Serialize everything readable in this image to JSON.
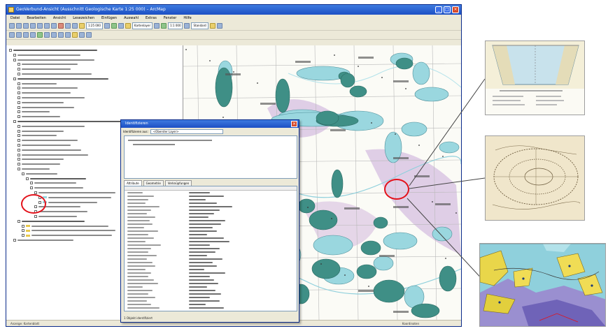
{
  "window": {
    "title": "GeoVerbund-Ansicht (Ausschnitt Geologische Karte 1:25 000) – ArcMap",
    "minimize": "_",
    "maximize": "□",
    "close": "×"
  },
  "menu": [
    "Datei",
    "Bearbeiten",
    "Ansicht",
    "Lesezeichen",
    "Einfügen",
    "Auswahl",
    "Extras",
    "Fenster",
    "Hilfe"
  ],
  "toolbar": {
    "scale": "1:25 000",
    "layer_combo": "Kartenlayer",
    "zoom_combo": "1:1 000",
    "style_combo": "Standard"
  },
  "dialog": {
    "title": "Identifizieren",
    "close": "×",
    "identify_from_label": "Identifizieren aus:",
    "identify_from_value": "<Oberster Layer>",
    "tabs": [
      "Attribute",
      "Geometrie",
      "Verknüpfungen"
    ],
    "status": "1 Objekt identifiziert"
  },
  "statusbar": {
    "left": "Anzeige: Kartenblatt",
    "right": "Koordinaten"
  },
  "colors": {
    "titlebar": "#2c5fd3",
    "water_blue": "#9ad7df",
    "teal": "#3f8f86",
    "lilac": "#c9a9d8",
    "marker_red": "#e3121b"
  },
  "callouts": [
    {
      "name": "Querprofil",
      "icon": "cross-section-drawing"
    },
    {
      "name": "Skizze",
      "icon": "sketch-map"
    },
    {
      "name": "Detailkarte",
      "icon": "colored-geological-map"
    }
  ]
}
